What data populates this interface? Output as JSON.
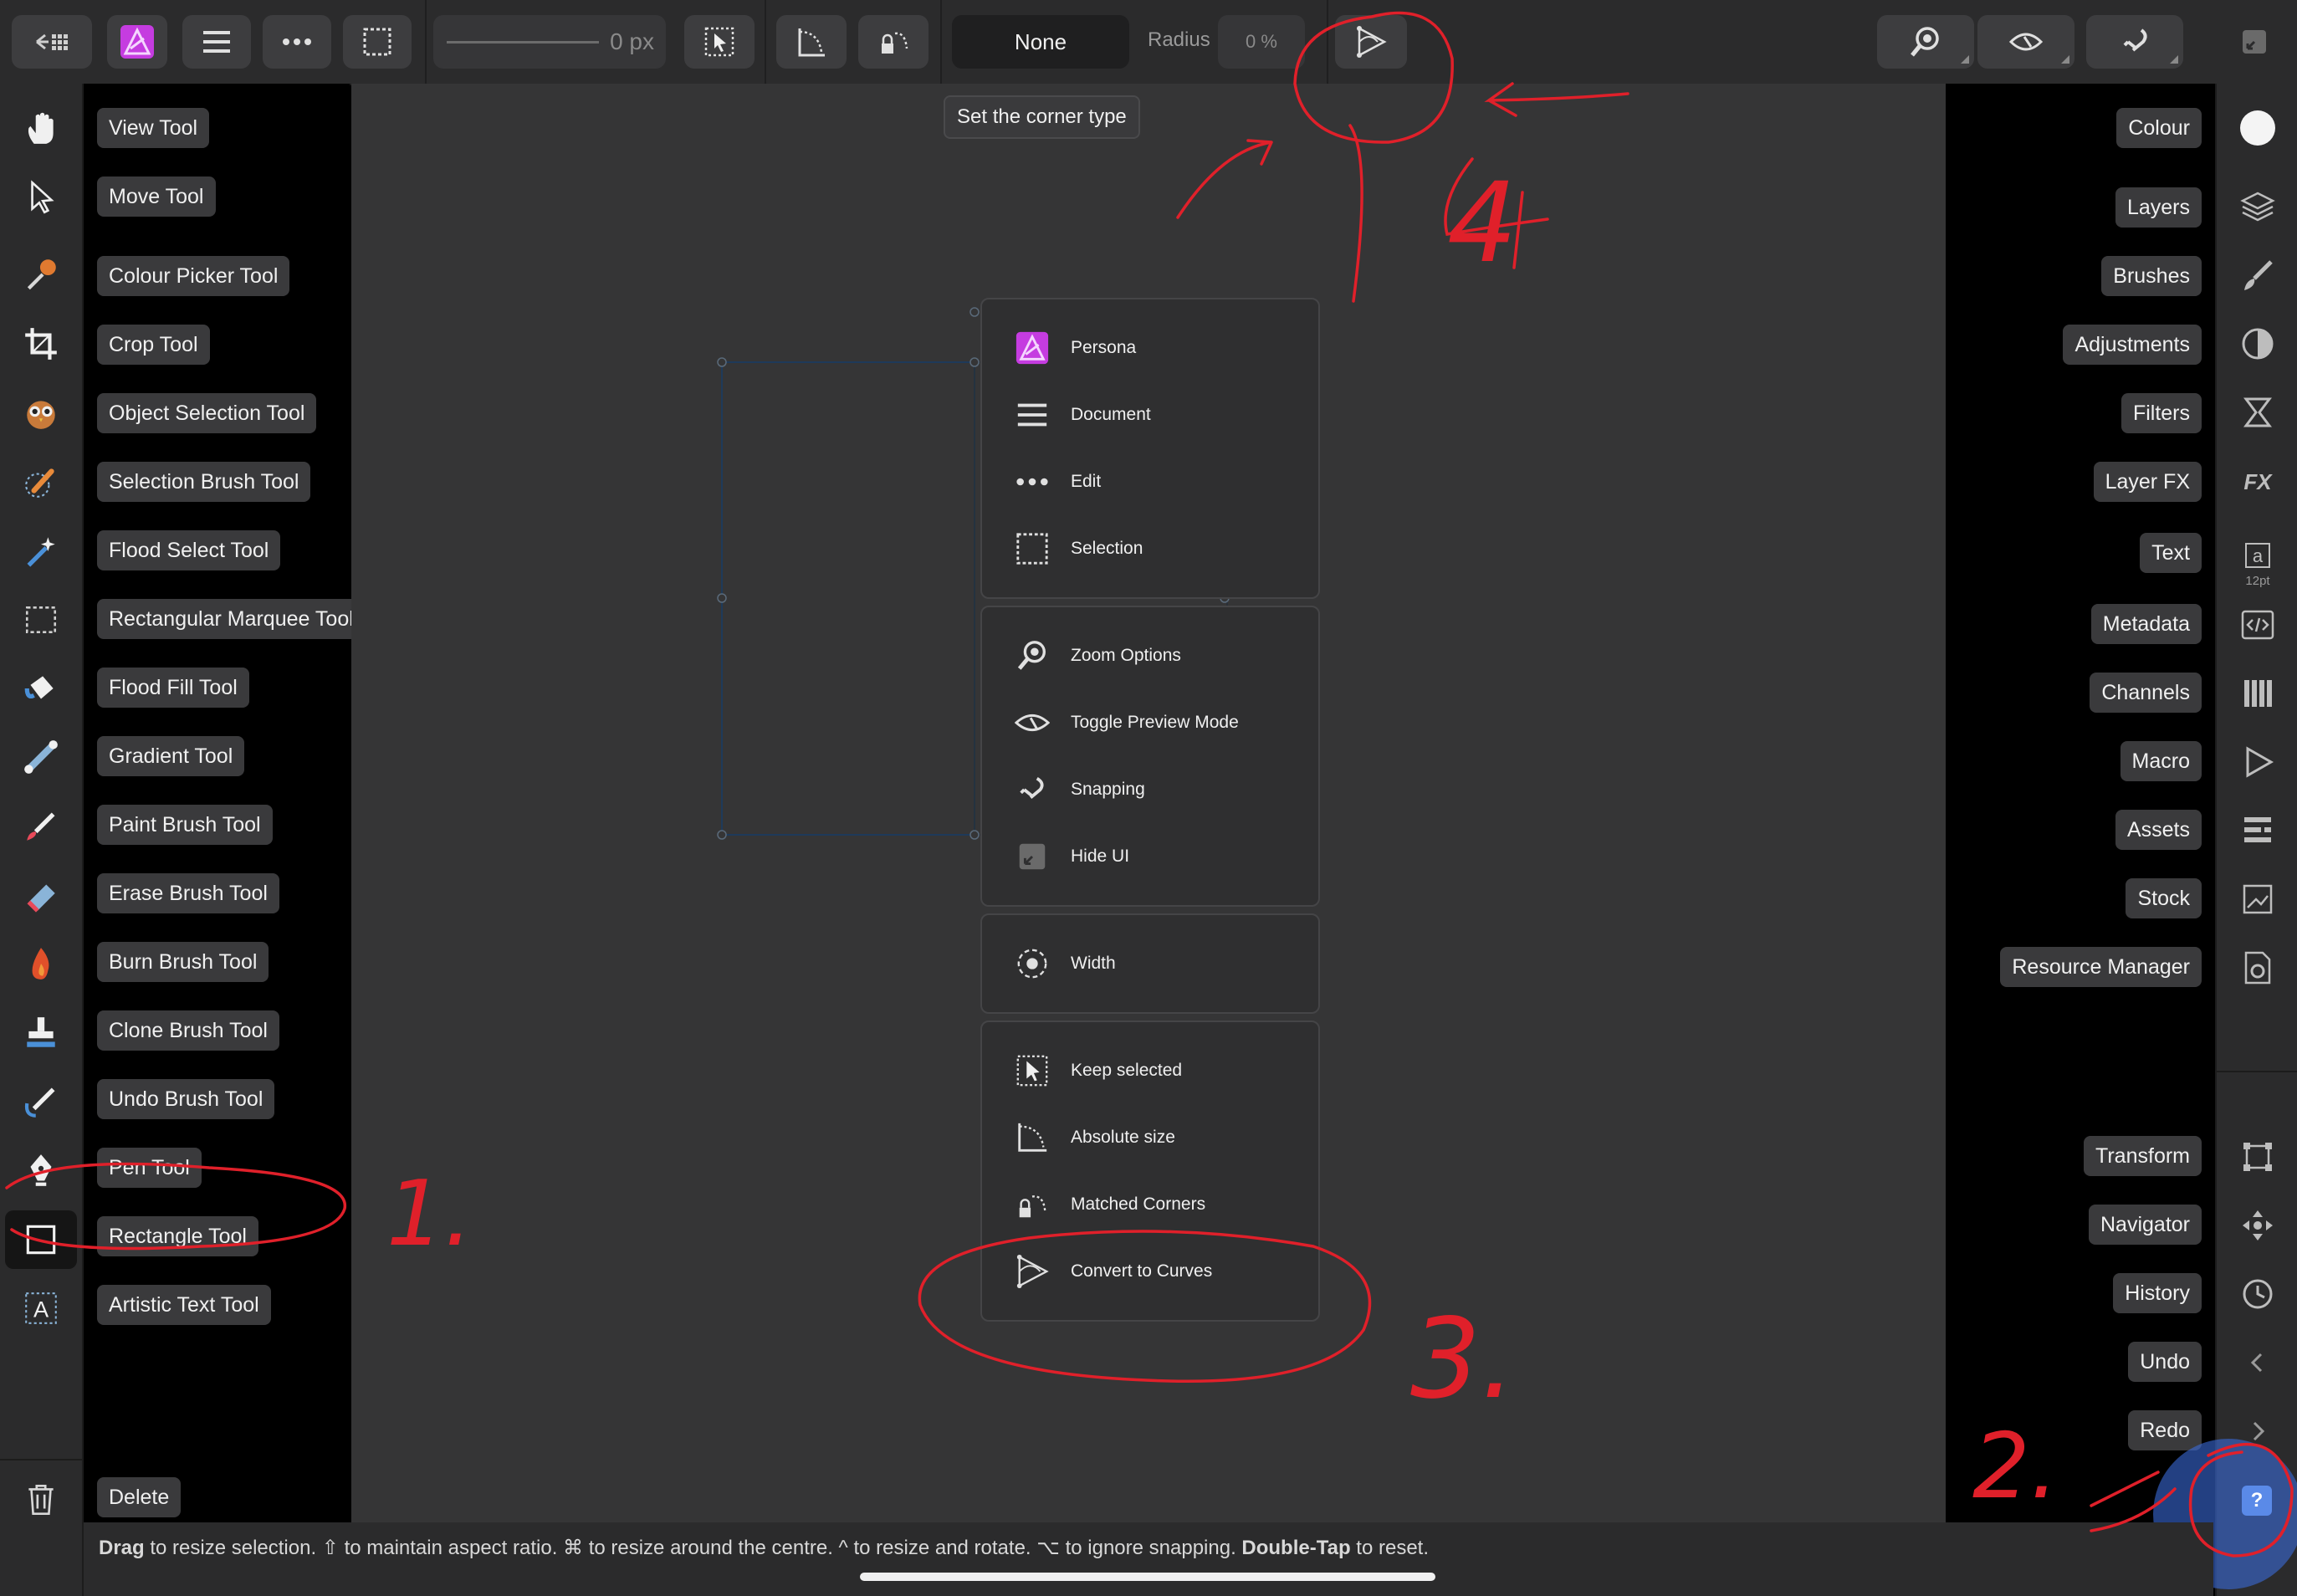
{
  "toolbar": {
    "width_value": "0 px",
    "corner_type": "None",
    "radius_label": "Radius",
    "radius_value": "0 %",
    "tooltip": "Set the corner type"
  },
  "tools": [
    {
      "icon": "hand-icon",
      "label": "View Tool"
    },
    {
      "icon": "pointer-icon",
      "label": "Move Tool"
    },
    {
      "icon": "eyedropper-icon",
      "label": "Colour Picker Tool"
    },
    {
      "icon": "crop-icon",
      "label": "Crop Tool"
    },
    {
      "icon": "owl-icon",
      "label": "Object Selection Tool"
    },
    {
      "icon": "selection-brush-icon",
      "label": "Selection Brush Tool"
    },
    {
      "icon": "magic-wand-icon",
      "label": "Flood Select Tool"
    },
    {
      "icon": "marquee-icon",
      "label": "Rectangular Marquee Tool"
    },
    {
      "icon": "paint-bucket-icon",
      "label": "Flood Fill Tool"
    },
    {
      "icon": "gradient-icon",
      "label": "Gradient Tool"
    },
    {
      "icon": "paint-brush-icon",
      "label": "Paint Brush Tool"
    },
    {
      "icon": "eraser-icon",
      "label": "Erase Brush Tool"
    },
    {
      "icon": "flame-icon",
      "label": "Burn Brush Tool"
    },
    {
      "icon": "stamp-icon",
      "label": "Clone Brush Tool"
    },
    {
      "icon": "undo-brush-icon",
      "label": "Undo Brush Tool"
    },
    {
      "icon": "pen-icon",
      "label": "Pen Tool"
    },
    {
      "icon": "rectangle-icon",
      "label": "Rectangle Tool"
    },
    {
      "icon": "text-icon",
      "label": "Artistic Text Tool"
    }
  ],
  "delete_label": "Delete",
  "panels_top": [
    "Colour",
    "Layers",
    "Brushes",
    "Adjustments",
    "Filters",
    "Layer FX",
    "Text",
    "Metadata",
    "Channels",
    "Macro",
    "Assets",
    "Stock",
    "Resource Manager"
  ],
  "panels_bottom": [
    "Transform",
    "Navigator",
    "History",
    "Undo",
    "Redo"
  ],
  "text_icon_sub": "12pt",
  "help_glyph": "?",
  "menu": {
    "group1": [
      "Persona",
      "Document",
      "Edit",
      "Selection"
    ],
    "group2": [
      "Zoom Options",
      "Toggle Preview Mode",
      "Snapping",
      "Hide UI"
    ],
    "group3": [
      "Width"
    ],
    "group4": [
      "Keep selected",
      "Absolute size",
      "Matched Corners",
      "Convert to Curves"
    ]
  },
  "status": {
    "b1": "Drag",
    "t1": " to resize selection. ⇧ to maintain aspect ratio. ⌘ to resize around the centre. ^ to resize and rotate. ⌥ to ignore snapping. ",
    "b2": "Double-Tap",
    "t2": " to reset."
  },
  "annotations": {
    "a1": "1.",
    "a2": "2.",
    "a3": "3.",
    "a4": "4"
  },
  "colors": {
    "accent": "#c53ce0",
    "annotation": "#e0202a",
    "highlight": "#3a6bd8"
  }
}
